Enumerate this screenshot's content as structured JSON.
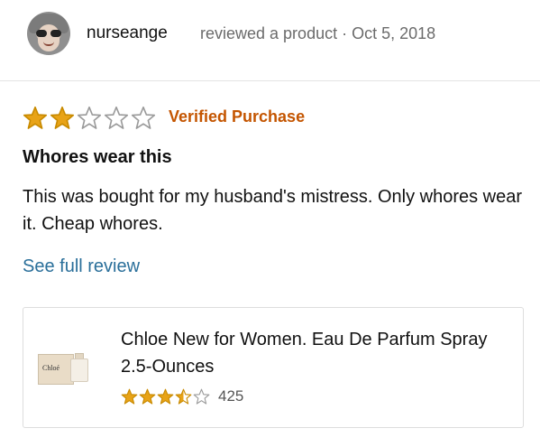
{
  "reviewer": {
    "username": "nurseange",
    "action_text": "reviewed a product · Oct 5, 2018",
    "avatar_icon": "user-avatar"
  },
  "review": {
    "rating": 2,
    "max_rating": 5,
    "verified_label": "Verified Purchase",
    "title": "Whores wear this",
    "body": "This was bought for my husband's mistress. Only whores wear it. Cheap whores.",
    "see_full_label": "See full review"
  },
  "product": {
    "name": "Chloe New for Women. Eau De Parfum Spray 2.5-Ounces",
    "image_label": "Chloé",
    "rating": 3.5,
    "max_rating": 5,
    "rating_count": "425"
  },
  "colors": {
    "star_fill": "#e8a317",
    "star_stroke": "#c88a00",
    "verified": "#c45500",
    "link": "#2a6f9a",
    "muted_text": "#6b6b6b"
  }
}
